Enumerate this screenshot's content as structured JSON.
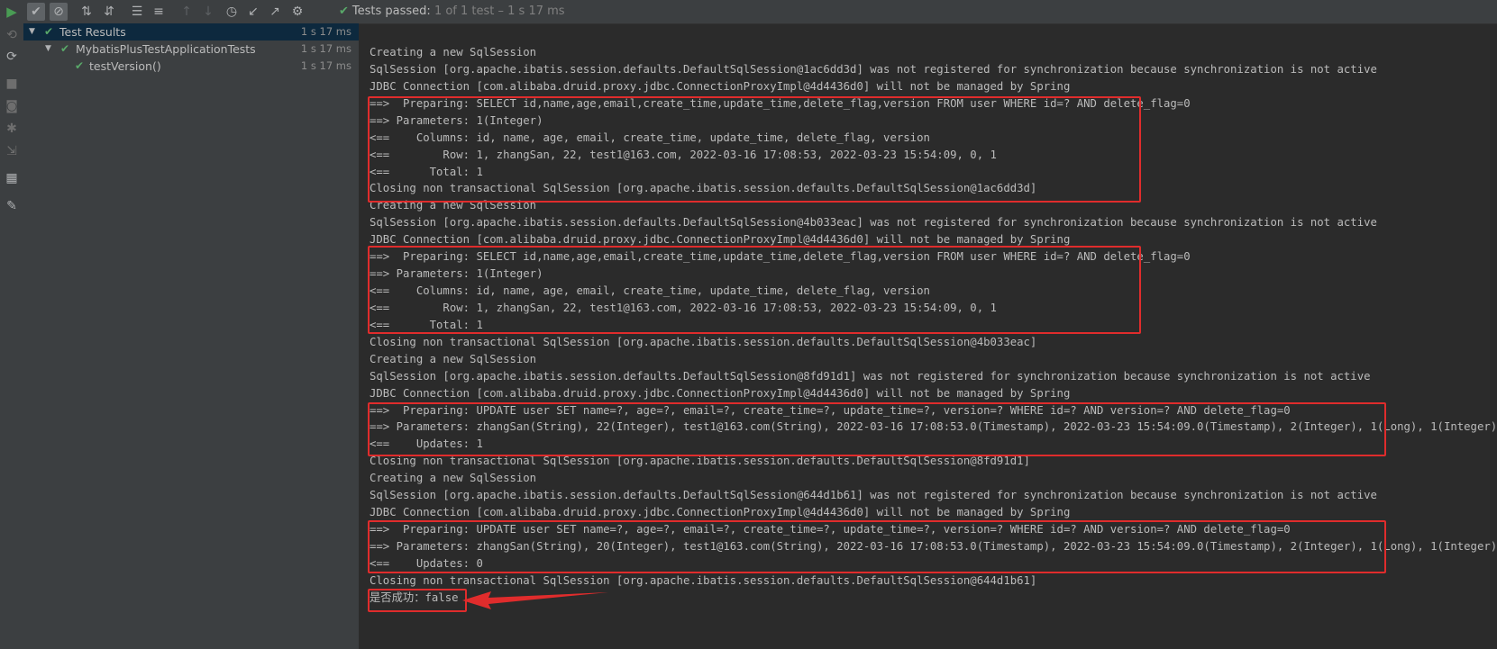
{
  "toolbar": {
    "status_icon": "check-icon",
    "status_prefix": "Tests passed:",
    "status_rest": "1 of 1 test – 1 s 17 ms"
  },
  "tree": [
    {
      "label": "Test Results",
      "time": "1 s 17 ms"
    },
    {
      "label": "MybatisPlusTestApplicationTests",
      "time": "1 s 17 ms"
    },
    {
      "label": "testVersion()",
      "time": "1 s 17 ms"
    }
  ],
  "console_lines": [
    "Creating a new SqlSession",
    "SqlSession [org.apache.ibatis.session.defaults.DefaultSqlSession@1ac6dd3d] was not registered for synchronization because synchronization is not active",
    "JDBC Connection [com.alibaba.druid.proxy.jdbc.ConnectionProxyImpl@4d4436d0] will not be managed by Spring",
    "==>  Preparing: SELECT id,name,age,email,create_time,update_time,delete_flag,version FROM user WHERE id=? AND delete_flag=0",
    "==> Parameters: 1(Integer)",
    "<==    Columns: id, name, age, email, create_time, update_time, delete_flag, version",
    "<==        Row: 1, zhangSan, 22, test1@163.com, 2022-03-16 17:08:53, 2022-03-23 15:54:09, 0, 1",
    "<==      Total: 1",
    "Closing non transactional SqlSession [org.apache.ibatis.session.defaults.DefaultSqlSession@1ac6dd3d]",
    "Creating a new SqlSession",
    "SqlSession [org.apache.ibatis.session.defaults.DefaultSqlSession@4b033eac] was not registered for synchronization because synchronization is not active",
    "JDBC Connection [com.alibaba.druid.proxy.jdbc.ConnectionProxyImpl@4d4436d0] will not be managed by Spring",
    "==>  Preparing: SELECT id,name,age,email,create_time,update_time,delete_flag,version FROM user WHERE id=? AND delete_flag=0",
    "==> Parameters: 1(Integer)",
    "<==    Columns: id, name, age, email, create_time, update_time, delete_flag, version",
    "<==        Row: 1, zhangSan, 22, test1@163.com, 2022-03-16 17:08:53, 2022-03-23 15:54:09, 0, 1",
    "<==      Total: 1",
    "Closing non transactional SqlSession [org.apache.ibatis.session.defaults.DefaultSqlSession@4b033eac]",
    "Creating a new SqlSession",
    "SqlSession [org.apache.ibatis.session.defaults.DefaultSqlSession@8fd91d1] was not registered for synchronization because synchronization is not active",
    "JDBC Connection [com.alibaba.druid.proxy.jdbc.ConnectionProxyImpl@4d4436d0] will not be managed by Spring",
    "==>  Preparing: UPDATE user SET name=?, age=?, email=?, create_time=?, update_time=?, version=? WHERE id=? AND version=? AND delete_flag=0",
    "==> Parameters: zhangSan(String), 22(Integer), test1@163.com(String), 2022-03-16 17:08:53.0(Timestamp), 2022-03-23 15:54:09.0(Timestamp), 2(Integer), 1(Long), 1(Integer)",
    "<==    Updates: 1",
    "Closing non transactional SqlSession [org.apache.ibatis.session.defaults.DefaultSqlSession@8fd91d1]",
    "Creating a new SqlSession",
    "SqlSession [org.apache.ibatis.session.defaults.DefaultSqlSession@644d1b61] was not registered for synchronization because synchronization is not active",
    "JDBC Connection [com.alibaba.druid.proxy.jdbc.ConnectionProxyImpl@4d4436d0] will not be managed by Spring",
    "==>  Preparing: UPDATE user SET name=?, age=?, email=?, create_time=?, update_time=?, version=? WHERE id=? AND version=? AND delete_flag=0",
    "==> Parameters: zhangSan(String), 20(Integer), test1@163.com(String), 2022-03-16 17:08:53.0(Timestamp), 2022-03-23 15:54:09.0(Timestamp), 2(Integer), 1(Long), 1(Integer)",
    "<==    Updates: 0",
    "Closing non transactional SqlSession [org.apache.ibatis.session.defaults.DefaultSqlSession@644d1b61]",
    "是否成功：false"
  ],
  "colors": {
    "highlight_box": "#e02c2c",
    "pass": "#59a869"
  }
}
